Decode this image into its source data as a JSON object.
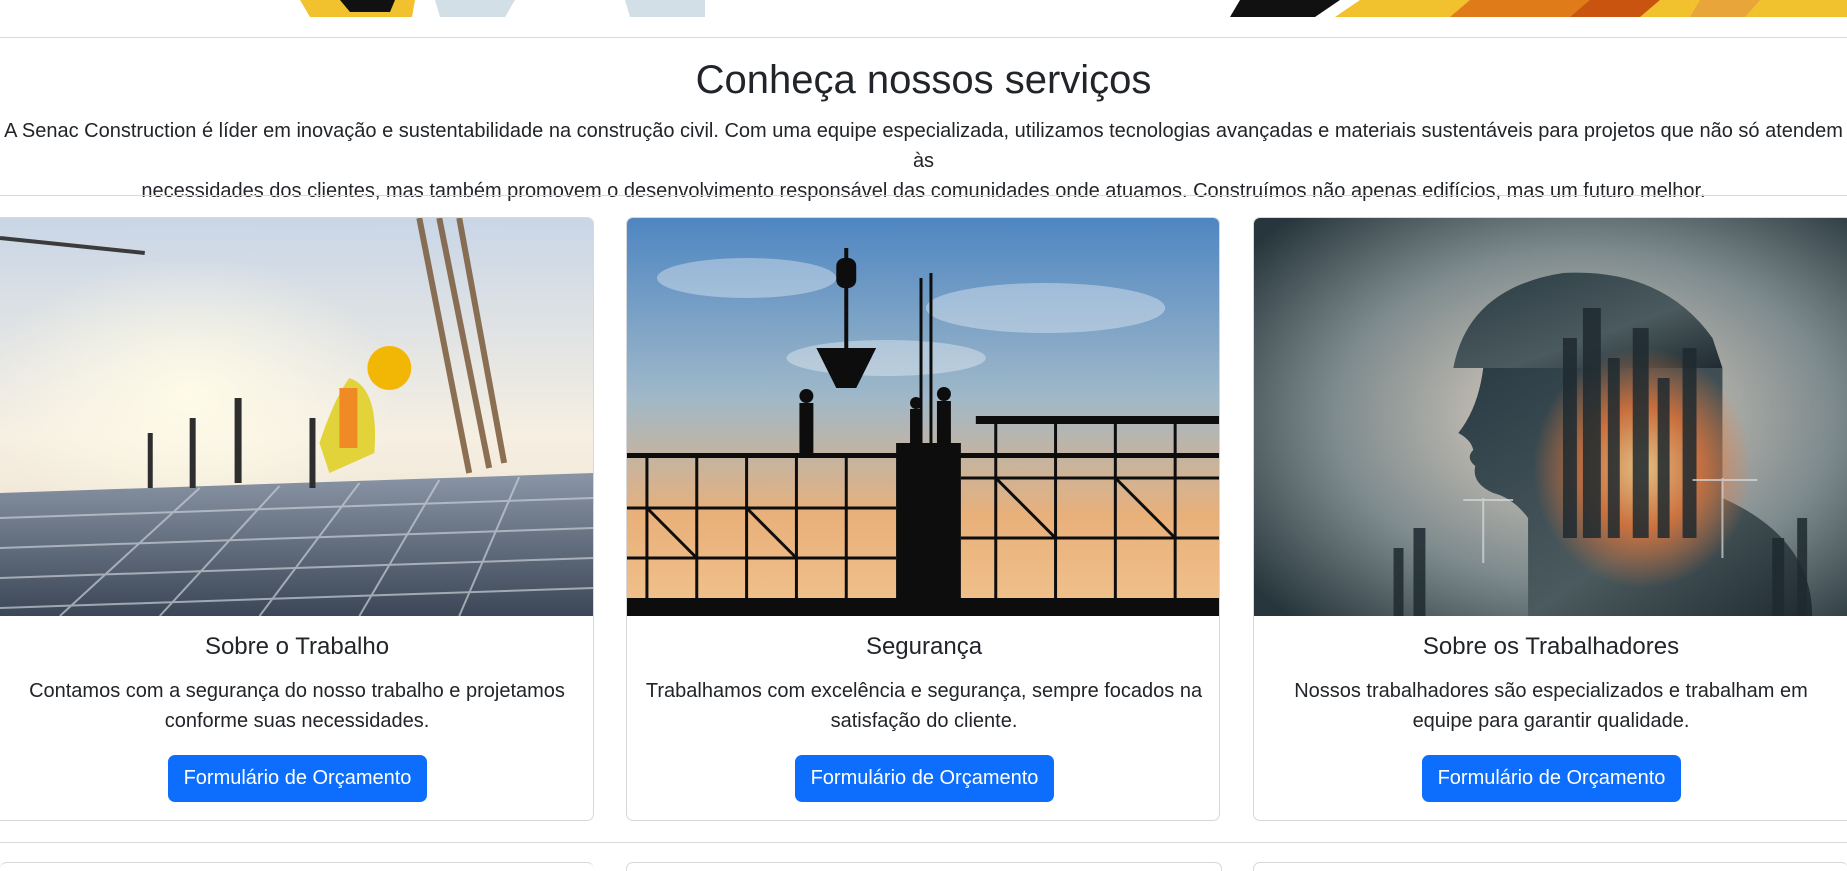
{
  "section": {
    "title": "Conheça nossos serviços",
    "intro_line1": "A Senac Construction é líder em inovação e sustentabilidade na construção civil. Com uma equipe especializada, utilizamos tecnologias avançadas e materiais sustentáveis para projetos que não só atendem às",
    "intro_line2": "necessidades dos clientes, mas também promovem o desenvolvimento responsável das comunidades onde atuamos. Construímos não apenas edifícios, mas um futuro melhor."
  },
  "cards": [
    {
      "title": "Sobre o Trabalho",
      "text_line1": "Contamos com a segurança do nosso trabalho e projetamos",
      "text_line2": "conforme suas necessidades.",
      "button": "Formulário de Orçamento"
    },
    {
      "title": "Segurança",
      "text_line1": "Trabalhamos com excelência e segurança, sempre focados na",
      "text_line2": "satisfação do cliente.",
      "button": "Formulário de Orçamento"
    },
    {
      "title": "Sobre os Trabalhadores",
      "text_line1": "Nossos trabalhadores são especializados e trabalham em",
      "text_line2": "equipe para garantir qualidade.",
      "button": "Formulário de Orçamento"
    }
  ],
  "colors": {
    "primary_button": "#0d6efd",
    "banner_yellow": "#f2c12e",
    "banner_orange": "#e07b1a"
  }
}
